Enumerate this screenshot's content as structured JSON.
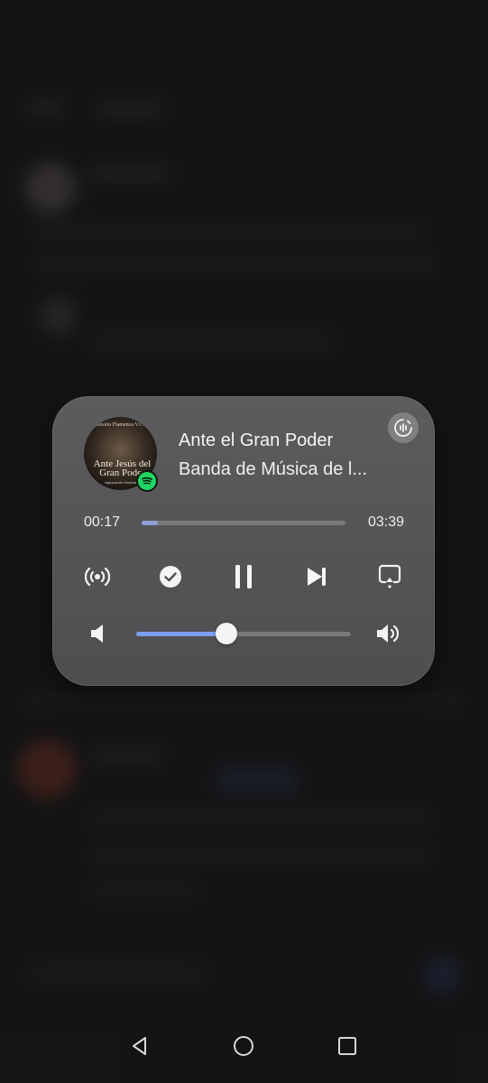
{
  "media": {
    "title": "Ante el Gran Poder",
    "artist": "Banda de Música de l...",
    "art": {
      "top_text": "Sesión Flamenca V.C.",
      "main_text": "Ante Jesús del Gran Poder",
      "bottom_text": "Agrupación Musical"
    },
    "elapsed": "00:17",
    "duration": "03:39",
    "progress_fraction": 0.08,
    "volume_fraction": 0.42,
    "source_app_icon": "spotify-icon",
    "accent_color": "#7b9ff0"
  },
  "controls": {
    "broadcast_icon": "broadcast-icon",
    "liked_icon": "check-circle-icon",
    "play_state_icon": "pause-icon",
    "next_icon": "skip-next-icon",
    "output_icon": "cast-output-icon",
    "volume_down_icon": "volume-low-icon",
    "volume_up_icon": "volume-high-icon"
  },
  "navbar": {
    "back_icon": "back-triangle-icon",
    "home_icon": "home-circle-icon",
    "recents_icon": "recents-square-icon"
  }
}
